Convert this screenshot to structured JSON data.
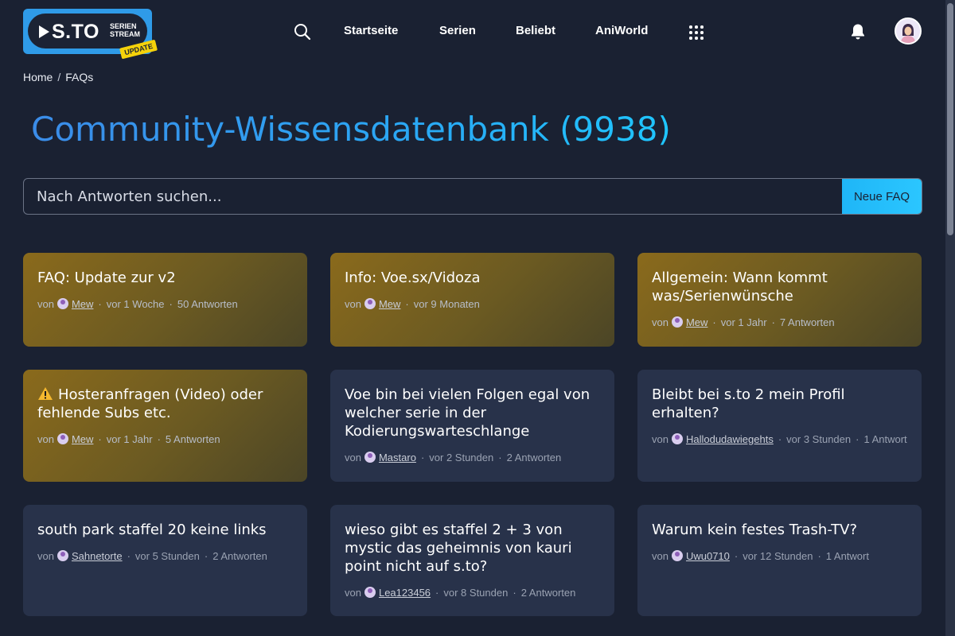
{
  "logo": {
    "text": "S.TO",
    "sub_line1": "SERIEN",
    "sub_line2": "STREAM",
    "badge": "UPDATE"
  },
  "nav": {
    "items": [
      "Startseite",
      "Serien",
      "Beliebt",
      "AniWorld"
    ]
  },
  "breadcrumb": {
    "home": "Home",
    "separator": "/",
    "current": "FAQs"
  },
  "page_title": "Community-Wissensdatenbank (9938)",
  "search": {
    "placeholder": "Nach Antworten suchen...",
    "button_label": "Neue FAQ"
  },
  "colors": {
    "accent": "#2aa8f4",
    "pinned_card": "#8a6a1c",
    "card": "#28324a",
    "background": "#1a2132"
  },
  "cards": [
    {
      "title": "FAQ: Update zur v2",
      "by": "von",
      "author": "Mew",
      "time": "vor 1 Woche",
      "sep": "·",
      "answers": "50 Antworten",
      "pinned": true
    },
    {
      "title": "Info: Voe.sx/Vidoza",
      "by": "von",
      "author": "Mew",
      "time": "vor 9 Monaten",
      "sep": "",
      "answers": "",
      "pinned": true
    },
    {
      "title": "Allgemein: Wann kommt was/Serienwünsche",
      "by": "von",
      "author": "Mew",
      "time": "vor 1 Jahr",
      "sep": "·",
      "answers": "7 Antworten",
      "pinned": true
    },
    {
      "title": "Hosteranfragen (Video) oder fehlende Subs etc.",
      "by": "von",
      "author": "Mew",
      "time": "vor 1 Jahr",
      "sep": "·",
      "answers": "5 Antworten",
      "pinned": true,
      "icon": "warning-icon"
    },
    {
      "title": "Voe bin bei vielen Folgen egal von welcher serie in der Kodierungswarteschlange",
      "by": "von",
      "author": "Mastaro",
      "time": "vor 2 Stunden",
      "sep": "·",
      "answers": "2 Antworten",
      "pinned": false
    },
    {
      "title": "Bleibt bei s.to 2 mein Profil erhalten?",
      "by": "von",
      "author": "Hallodudawiegehts",
      "time": "vor 3 Stunden",
      "sep": "·",
      "answers": "1 Antwort",
      "pinned": false
    },
    {
      "title": "south park staffel 20 keine links",
      "by": "von",
      "author": "Sahnetorte",
      "time": "vor 5 Stunden",
      "sep": "·",
      "answers": "2 Antworten",
      "pinned": false
    },
    {
      "title": "wieso gibt es staffel 2 + 3 von mystic das geheimnis von kauri point nicht auf s.to?",
      "by": "von",
      "author": "Lea123456",
      "time": "vor 8 Stunden",
      "sep": "·",
      "answers": "2 Antworten",
      "pinned": false
    },
    {
      "title": "Warum kein festes Trash-TV?",
      "by": "von",
      "author": "Uwu0710",
      "time": "vor 12 Stunden",
      "sep": "·",
      "answers": "1 Antwort",
      "pinned": false
    }
  ]
}
